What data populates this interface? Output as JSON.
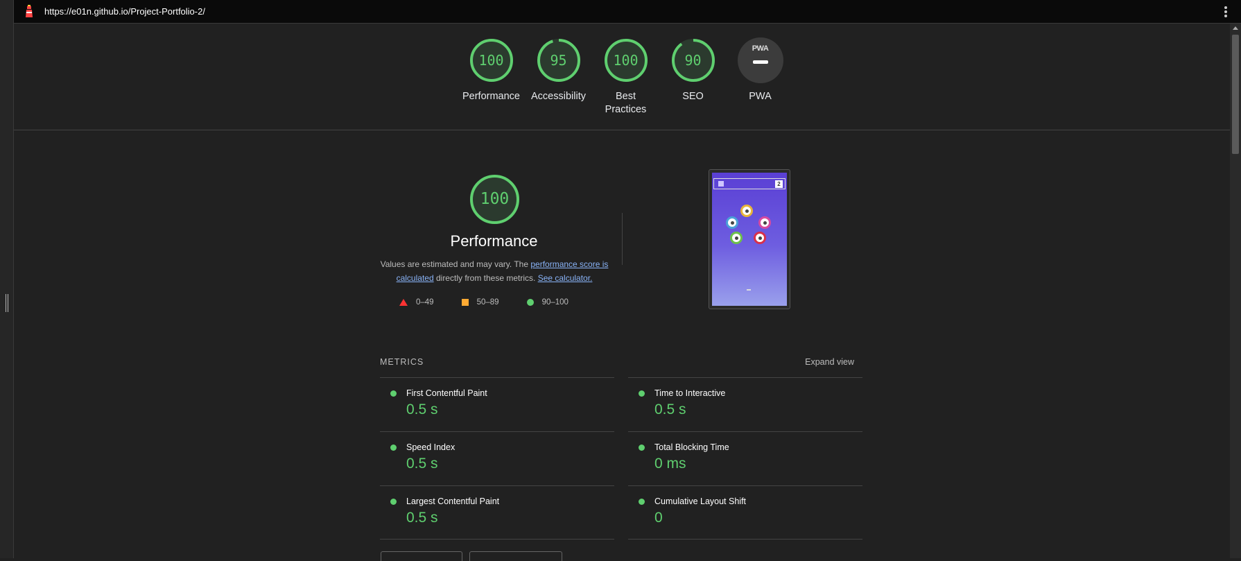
{
  "browser": {
    "url": "https://e01n.github.io/Project-Portfolio-2/"
  },
  "top_scores": [
    {
      "label": "Performance",
      "score": "100",
      "value": 100
    },
    {
      "label": "Accessibility",
      "score": "95",
      "value": 95
    },
    {
      "label": "Best Practices",
      "score": "100",
      "value": 100
    },
    {
      "label": "SEO",
      "score": "90",
      "value": 90
    }
  ],
  "pwa": {
    "label": "PWA",
    "badge": "PWA"
  },
  "performance": {
    "score": "100",
    "title": "Performance",
    "desc_part1": "Values are estimated and may vary. The ",
    "desc_link1": "performance score is calculated",
    "desc_part2": " directly from these metrics. ",
    "desc_link2": "See calculator."
  },
  "legend": {
    "fail": "0–49",
    "average": "50–89",
    "pass": "90–100"
  },
  "colors": {
    "pass": "#5fcf6f",
    "average": "#ffaa33",
    "fail": "#ff3333",
    "link": "#8ab4f8"
  },
  "screenshot_thumb": {
    "counter": "2"
  },
  "metrics": {
    "heading": "METRICS",
    "expand_label": "Expand view",
    "items": [
      {
        "name": "First Contentful Paint",
        "value": "0.5 s"
      },
      {
        "name": "Time to Interactive",
        "value": "0.5 s"
      },
      {
        "name": "Speed Index",
        "value": "0.5 s"
      },
      {
        "name": "Total Blocking Time",
        "value": "0 ms"
      },
      {
        "name": "Largest Contentful Paint",
        "value": "0.5 s"
      },
      {
        "name": "Cumulative Layout Shift",
        "value": "0"
      }
    ]
  }
}
